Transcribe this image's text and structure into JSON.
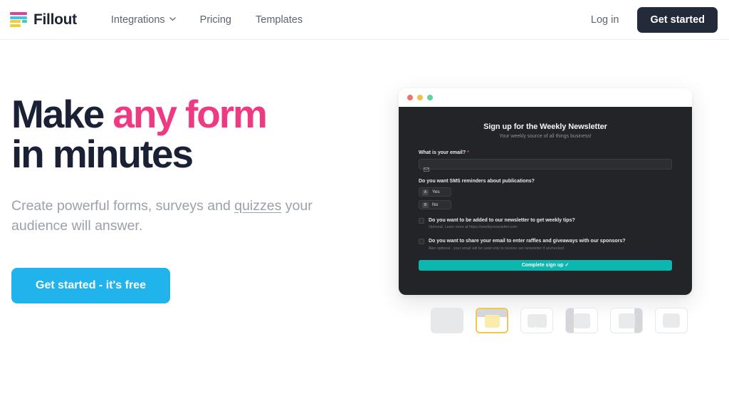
{
  "nav": {
    "brand_name": "Fillout",
    "logo_icon": "fillout-logo-bars-icon",
    "links": [
      {
        "label": "Integrations",
        "has_dropdown": true,
        "icon": "chevron-down-icon"
      },
      {
        "label": "Pricing",
        "has_dropdown": false
      },
      {
        "label": "Templates",
        "has_dropdown": false
      }
    ],
    "login_label": "Log in",
    "get_started_label": "Get started"
  },
  "hero": {
    "headline_part1": "Make ",
    "headline_accent": "any form",
    "headline_part2": "in minutes",
    "subhead_before": "Create powerful forms, surveys and ",
    "subhead_underlined": "quizzes",
    "subhead_after": " your audience will answer.",
    "cta_label": "Get started - it's free"
  },
  "mockup": {
    "window_dots": [
      "red",
      "yellow",
      "green"
    ],
    "form_title": "Sign up for the Weekly Newsletter",
    "form_subtitle": "Your weekly source of all things business!",
    "fields": [
      {
        "label": "What is your email?",
        "required_marker": "*",
        "input_value": "",
        "input_icon": "envelope-icon"
      }
    ],
    "sms_question": "Do you want SMS reminders about publications?",
    "choices": [
      {
        "key": "A",
        "label": "Yes"
      },
      {
        "key": "B",
        "label": "No"
      }
    ],
    "checkboxes": [
      {
        "label": "Do you want to be added to our newsletter to get weekly tips?",
        "help": "Optional. Learn more at https://weeklynewsletter.com",
        "checked": false
      },
      {
        "label": "Do you want to share your email to enter raffles and giveaways with our sponsors?",
        "help": "Also optional - your email will be used only to receive our newsletter if unchecked",
        "checked": false
      }
    ],
    "submit_label": "Complete sign up ✓"
  },
  "layout_thumbnails": {
    "selected_index": 1,
    "items": [
      {
        "name": "layout-plain",
        "variant": "plain",
        "selected": false
      },
      {
        "name": "layout-card-top",
        "variant": "card-top",
        "selected": true
      },
      {
        "name": "layout-image",
        "variant": "image",
        "selected": false
      },
      {
        "name": "layout-split-left",
        "variant": "split-left",
        "selected": false
      },
      {
        "name": "layout-split-right",
        "variant": "split-right",
        "selected": false
      },
      {
        "name": "layout-centered",
        "variant": "centered",
        "selected": false
      }
    ]
  },
  "colors": {
    "accent_pink": "#ed3a82",
    "cta_blue": "#21b4ec",
    "dark_navy": "#232a3a",
    "teal": "#0bb7ae",
    "thumb_selected_border": "#f0c954"
  }
}
